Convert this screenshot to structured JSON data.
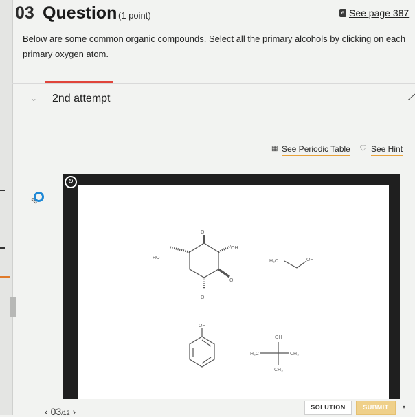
{
  "header": {
    "number": "03",
    "title": "Question",
    "points": "(1 point)",
    "ebook_icon": "e",
    "see_page": "See page 387"
  },
  "prompt": "Below are some common organic compounds. Select all the primary alcohols by clicking on each primary oxygen atom.",
  "attempt": {
    "chevron": "⌄",
    "label": "2nd attempt"
  },
  "tools": {
    "periodic_icon": "▦",
    "periodic_label": "See Periodic Table",
    "hint_icon": "♡",
    "hint_label": "See Hint"
  },
  "canvas": {
    "reset_icon": "↻",
    "labels": {
      "ring_top_oh": "OH",
      "ring_right_oh1": "OH",
      "ring_right_oh2": "OH",
      "ring_left_ho": "HO",
      "ring_bottom_oh": "OH",
      "ethanol_h3c": "H₃C",
      "ethanol_oh": "OH",
      "phenol_oh": "OH",
      "tbutanol_oh": "OH",
      "tbutanol_h3c": "H₃C",
      "tbutanol_ch3_right": "CH₃",
      "tbutanol_ch3_bottom": "CH₃"
    }
  },
  "footer": {
    "prev": "‹",
    "page": "03",
    "total": "/12",
    "next": "›",
    "solution": "SOLUTION",
    "submit": "SUBMIT"
  }
}
